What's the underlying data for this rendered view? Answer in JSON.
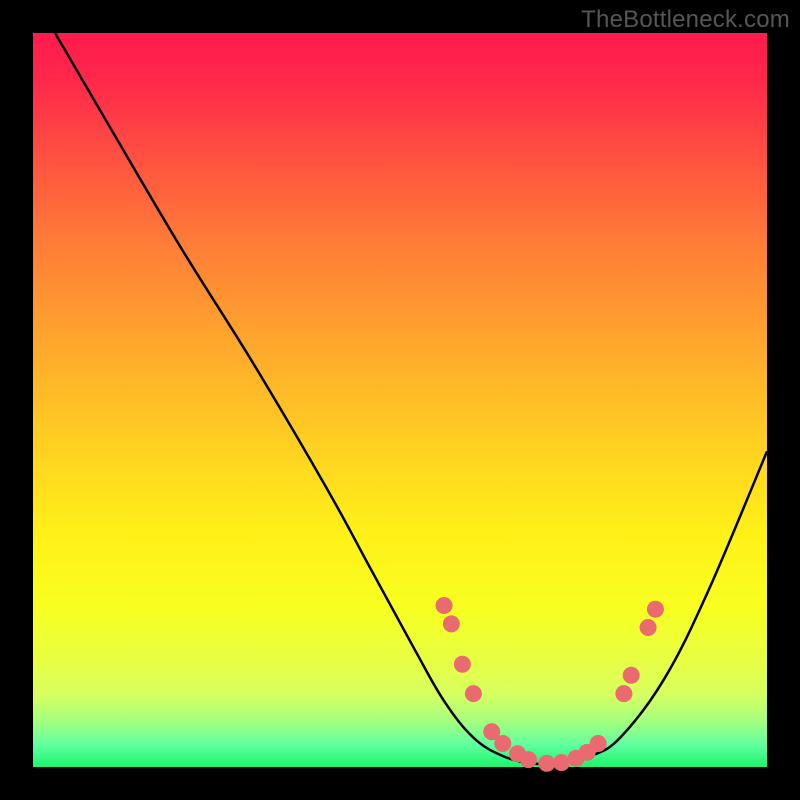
{
  "watermark": "TheBottleneck.com",
  "chart_data": {
    "type": "line",
    "title": "",
    "xlabel": "",
    "ylabel": "",
    "xlim": [
      0,
      100
    ],
    "ylim": [
      0,
      100
    ],
    "series": [
      {
        "name": "curve",
        "x": [
          3,
          10,
          20,
          30,
          40,
          46,
          52,
          56,
          60,
          64,
          68,
          72,
          76,
          80,
          86,
          92,
          100
        ],
        "y": [
          100,
          88,
          71,
          55,
          38,
          27,
          16,
          9,
          4,
          1.5,
          0.5,
          0.5,
          1.5,
          4,
          12,
          24,
          43
        ]
      }
    ],
    "markers": [
      {
        "name": "left-cluster-1",
        "x": 56.0,
        "y": 22.0
      },
      {
        "name": "left-cluster-2",
        "x": 57.0,
        "y": 19.5
      },
      {
        "name": "left-cluster-3",
        "x": 58.5,
        "y": 14.0
      },
      {
        "name": "left-cluster-4",
        "x": 60.0,
        "y": 10.0
      },
      {
        "name": "bottom-1",
        "x": 62.5,
        "y": 4.8
      },
      {
        "name": "bottom-2",
        "x": 64.0,
        "y": 3.2
      },
      {
        "name": "bottom-3",
        "x": 66.0,
        "y": 1.8
      },
      {
        "name": "bottom-4",
        "x": 67.5,
        "y": 1.0
      },
      {
        "name": "bottom-5",
        "x": 70.0,
        "y": 0.5
      },
      {
        "name": "bottom-6",
        "x": 72.0,
        "y": 0.6
      },
      {
        "name": "bottom-7",
        "x": 74.0,
        "y": 1.2
      },
      {
        "name": "bottom-8",
        "x": 75.5,
        "y": 2.0
      },
      {
        "name": "bottom-9",
        "x": 77.0,
        "y": 3.2
      },
      {
        "name": "right-cluster-1",
        "x": 80.5,
        "y": 10.0
      },
      {
        "name": "right-cluster-2",
        "x": 81.5,
        "y": 12.5
      },
      {
        "name": "right-cluster-3",
        "x": 83.8,
        "y": 19.0
      },
      {
        "name": "right-cluster-4",
        "x": 84.8,
        "y": 21.5
      }
    ],
    "colors": {
      "curve_stroke": "#000000",
      "marker_fill": "#e96a6f"
    }
  }
}
